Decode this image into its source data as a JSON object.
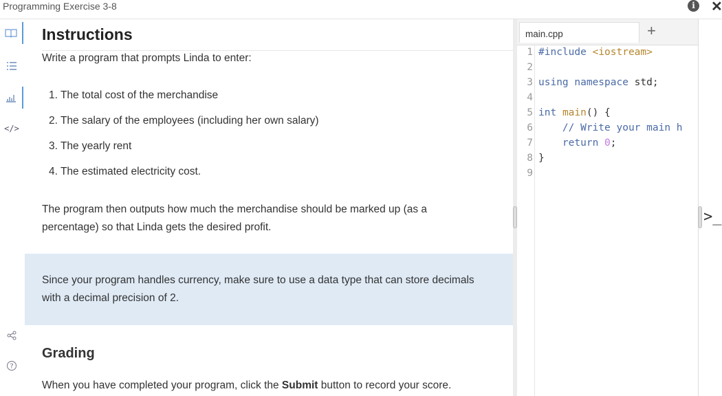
{
  "window": {
    "title": "Programming Exercise 3-8"
  },
  "instructions": {
    "heading": "Instructions",
    "intro": "Write a program that prompts Linda to enter:",
    "steps": [
      "1. The total cost of the merchandise",
      "2. The salary of the employees (including her own salary)",
      "3. The yearly rent",
      "4. The estimated electricity cost."
    ],
    "paragraph": "The program then outputs how much the merchandise should be marked up (as a percentage) so that Linda gets the desired profit.",
    "note": "Since your program handles currency, make sure to use a data type that can store decimals with a decimal precision of 2.",
    "grading_heading": "Grading",
    "grading_text_before": "When you have completed your program, click the ",
    "grading_text_bold": "Submit",
    "grading_text_after": " button to record your score."
  },
  "editor": {
    "tab_label": "main.cpp",
    "add_tab": "+",
    "line_numbers": [
      "1",
      "2",
      "3",
      "4",
      "5",
      "6",
      "7",
      "8",
      "9"
    ],
    "code": {
      "l1_kw": "#include",
      "l1_str": "<iostream>",
      "l3_kw": "using namespace",
      "l3_rest": " std;",
      "l5_kw": "int",
      "l5_fn": "main",
      "l5_rest": "() {",
      "l6_cm": "// Write your main h",
      "l7_kw": "return",
      "l7_num": "0",
      "l7_rest": ";",
      "l8": "}"
    }
  },
  "icons": {
    "sidebar": [
      "book-icon",
      "list-icon",
      "chart-icon",
      "code-icon",
      "share-icon",
      "help-icon"
    ],
    "terminal": ">_",
    "info": "i",
    "close": "✕"
  }
}
